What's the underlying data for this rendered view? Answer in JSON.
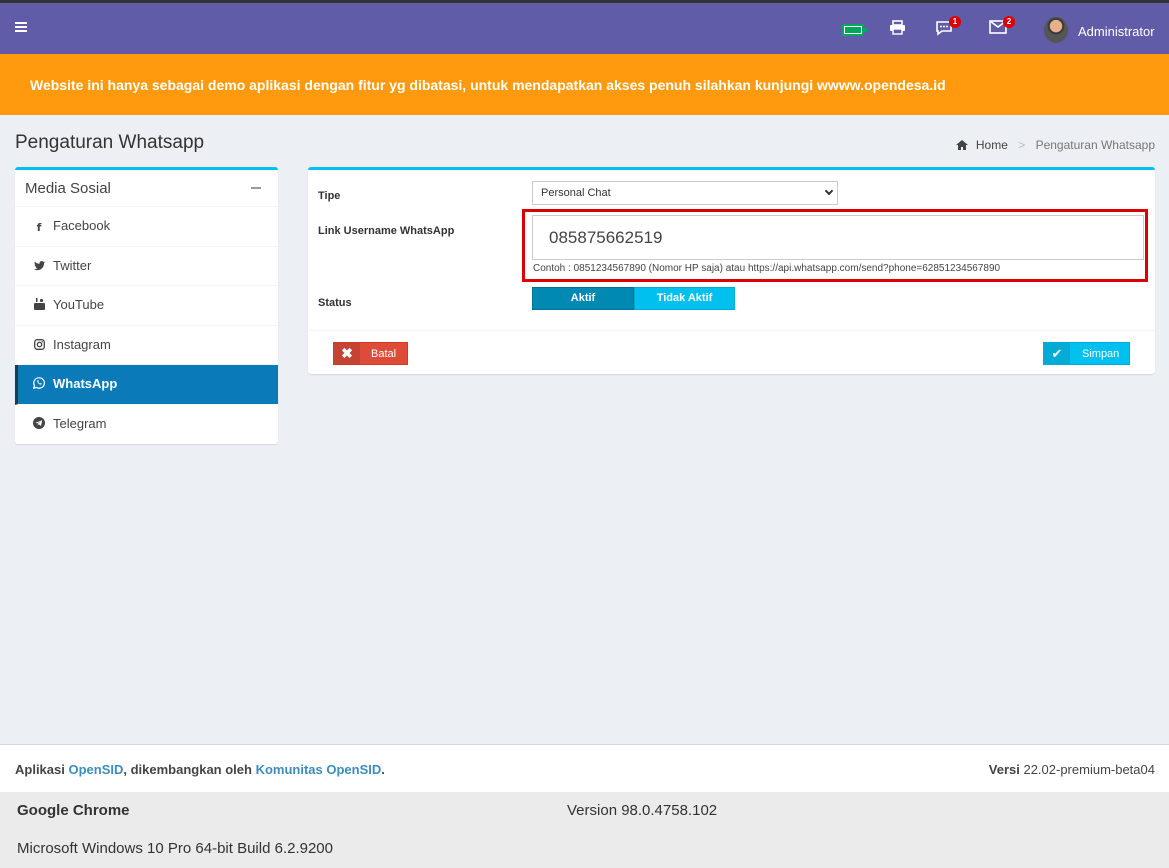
{
  "topbar": {
    "chat_badge": "1",
    "mail_badge": "2",
    "user_name": "Administrator"
  },
  "banner": {
    "text": "Website ini hanya sebagai demo aplikasi dengan fitur yg dibatasi, untuk mendapatkan akses penuh silahkan kunjungi wwww.opendesa.id"
  },
  "page": {
    "title": "Pengaturan Whatsapp",
    "breadcrumb_home": "Home",
    "breadcrumb_current": "Pengaturan Whatsapp"
  },
  "sidebar": {
    "title": "Media Sosial",
    "items": [
      {
        "label": "Facebook",
        "icon": "facebook-icon"
      },
      {
        "label": "Twitter",
        "icon": "twitter-icon"
      },
      {
        "label": "YouTube",
        "icon": "youtube-icon"
      },
      {
        "label": "Instagram",
        "icon": "instagram-icon"
      },
      {
        "label": "WhatsApp",
        "icon": "whatsapp-icon",
        "active": true
      },
      {
        "label": "Telegram",
        "icon": "telegram-icon"
      }
    ]
  },
  "form": {
    "tipe_label": "Tipe",
    "tipe_value": "Personal Chat",
    "link_label": "Link Username WhatsApp",
    "link_value": "085875662519",
    "link_hint": "Contoh : 0851234567890 (Nomor HP saja) atau https://api.whatsapp.com/send?phone=62851234567890",
    "status_label": "Status",
    "status_on": "Aktif",
    "status_off": "Tidak Aktif",
    "cancel_label": "Batal",
    "save_label": "Simpan"
  },
  "footer": {
    "prefix": "Aplikasi ",
    "app_link": "OpenSID",
    "middle": ", dikembangkan oleh ",
    "community_link": "Komunitas OpenSID",
    "suffix": ".",
    "version_label": "Versi",
    "version_value": " 22.02-premium-beta04"
  },
  "system": {
    "browser": "Google Chrome",
    "version": "Version 98.0.4758.102",
    "os": "Microsoft Windows 10 Pro 64-bit Build 6.2.9200"
  },
  "colors": {
    "topbar": "#605ca8",
    "banner": "#ff9a0e",
    "accent": "#00c0ef",
    "active_item": "#0a7ab8",
    "danger": "#dd4b39",
    "highlight": "#dd0000"
  }
}
